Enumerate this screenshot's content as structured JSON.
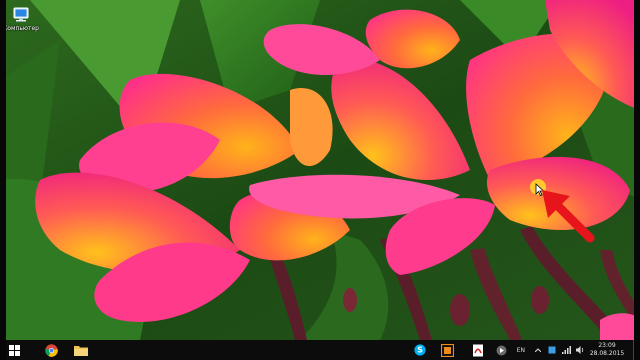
{
  "desktop": {
    "icons": [
      {
        "label": "Компьютер",
        "icon": "computer-icon"
      }
    ],
    "wallpaper": "pink-frangipani-flowers"
  },
  "taskbar": {
    "pinned": [
      {
        "name": "chrome-icon"
      },
      {
        "name": "file-explorer-icon"
      }
    ],
    "running": [
      {
        "name": "skype-icon"
      },
      {
        "name": "screen-recorder-icon"
      },
      {
        "name": "pdf-reader-icon"
      },
      {
        "name": "media-icon"
      }
    ],
    "tray": {
      "language": "EN",
      "time": "23:09",
      "date": "28.08.2015"
    }
  },
  "colors": {
    "taskbar": "#0c0c0c",
    "highlight": "#ffdc28",
    "annotation": "#e8141c"
  }
}
